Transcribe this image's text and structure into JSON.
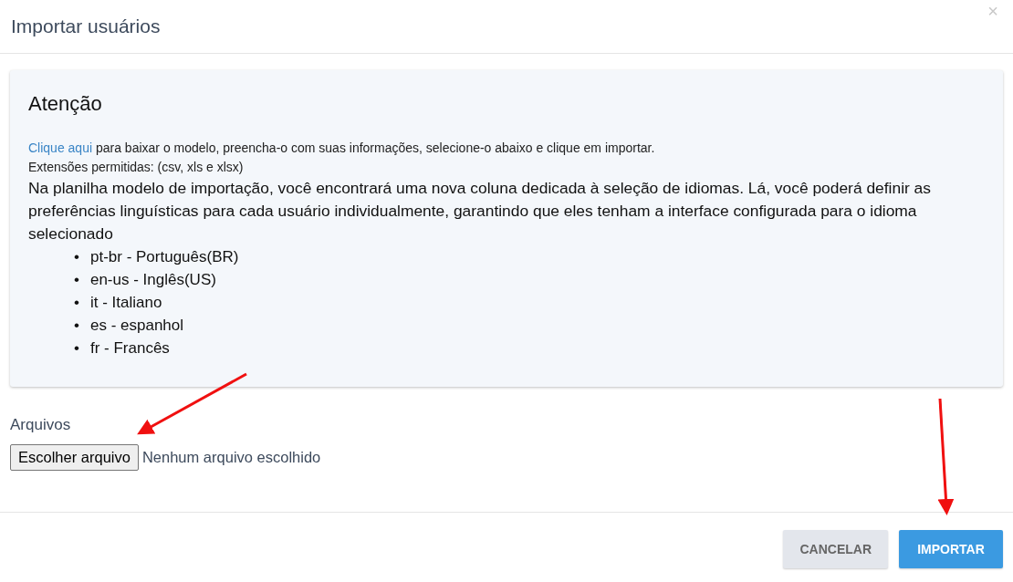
{
  "modal": {
    "title": "Importar usuários",
    "close": "×"
  },
  "notice": {
    "heading": "Atenção",
    "link": "Clique aqui",
    "intro": " para baixar o modelo, preencha-o com suas informações, selecione-o abaixo e clique em importar.",
    "extensions": "Extensões permitidas: (csv, xls e xlsx)",
    "description": "Na planilha modelo de importação, você encontrará uma nova coluna dedicada à seleção de idiomas. Lá, você poderá definir as preferências linguísticas para cada usuário individualmente, garantindo que eles tenham a interface configurada para o idioma selecionado",
    "languages": [
      {
        "bullet": "•",
        "text": "pt-br - Português(BR)"
      },
      {
        "bullet": "•",
        "text": "en-us - Inglês(US)"
      },
      {
        "bullet": "•",
        "text": "it - Italiano"
      },
      {
        "bullet": "•",
        "text": "es - espanhol"
      },
      {
        "bullet": "•",
        "text": "fr - Francês"
      }
    ]
  },
  "file_field": {
    "label": "Arquivos",
    "button": "Escolher arquivo",
    "status": "Nenhum arquivo escolhido"
  },
  "buttons": [
    {
      "label": "CANCELAR",
      "kind": "secondary"
    },
    {
      "label": "IMPORTAR",
      "kind": "primary"
    }
  ]
}
